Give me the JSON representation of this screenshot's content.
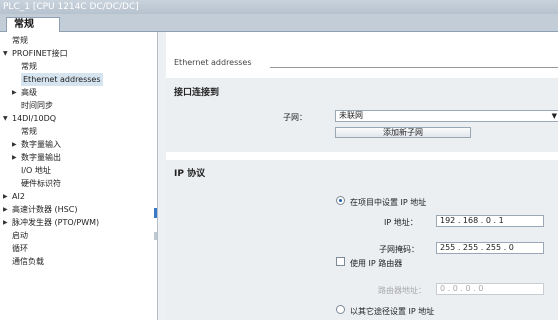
{
  "window": {
    "title": "PLC_1 [CPU 1214C DC/DC/DC]"
  },
  "tabs": [
    {
      "label": "常规"
    }
  ],
  "nav": {
    "items": [
      {
        "label": "常规",
        "indent": 0,
        "arrow": ""
      },
      {
        "label": "PROFINET接口",
        "indent": 0,
        "arrow": "▼"
      },
      {
        "label": "常规",
        "indent": 1,
        "arrow": ""
      },
      {
        "label": "Ethernet addresses",
        "indent": 1,
        "arrow": "",
        "selected": true
      },
      {
        "label": "高级",
        "indent": 1,
        "arrow": "▶"
      },
      {
        "label": "时间同步",
        "indent": 1,
        "arrow": ""
      },
      {
        "label": "14DI/10DQ",
        "indent": 0,
        "arrow": "▼"
      },
      {
        "label": "常规",
        "indent": 1,
        "arrow": ""
      },
      {
        "label": "数字量输入",
        "indent": 1,
        "arrow": "▶"
      },
      {
        "label": "数字量输出",
        "indent": 1,
        "arrow": "▶"
      },
      {
        "label": "I/O 地址",
        "indent": 1,
        "arrow": ""
      },
      {
        "label": "硬件标识符",
        "indent": 1,
        "arrow": ""
      },
      {
        "label": "AI2",
        "indent": 0,
        "arrow": "▶"
      },
      {
        "label": "高速计数器 (HSC)",
        "indent": 0,
        "arrow": "▶"
      },
      {
        "label": "脉冲发生器 (PTO/PWM)",
        "indent": 0,
        "arrow": "▶"
      },
      {
        "label": "启动",
        "indent": 0,
        "arrow": ""
      },
      {
        "label": "循环",
        "indent": 0,
        "arrow": ""
      },
      {
        "label": "通信负载",
        "indent": 0,
        "arrow": ""
      }
    ]
  },
  "content": {
    "heading": "Ethernet addresses",
    "interface": {
      "title": "接口连接到",
      "subnet_label": "子网：",
      "subnet_value": "未联网",
      "add_subnet_button": "添加新子网"
    },
    "ip": {
      "title": "IP 协议",
      "option_project": "在项目中设置 IP 地址",
      "ip_label": "IP 地址：",
      "ip_octets": [
        "192",
        "168",
        "0",
        "1"
      ],
      "mask_label": "子网掩码：",
      "mask_octets": [
        "255",
        "255",
        "255",
        "0"
      ],
      "use_router": "使用 IP 路由器",
      "router_label": "路由器地址：",
      "router_octets": [
        "0",
        "0",
        "0",
        "0"
      ],
      "option_other": "以其它途径设置 IP 地址"
    }
  }
}
